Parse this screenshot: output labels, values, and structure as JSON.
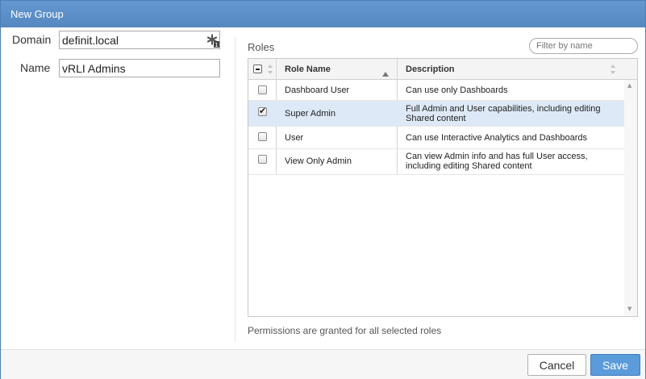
{
  "dialog": {
    "title": "New Group"
  },
  "form": {
    "domain_label": "Domain",
    "domain_value": "definit.local",
    "name_label": "Name",
    "name_value": "vRLI Admins"
  },
  "roles": {
    "label": "Roles",
    "filter_placeholder": "Filter by name",
    "columns": [
      "Role Name",
      "Description"
    ],
    "rows": [
      {
        "name": "Dashboard User",
        "description": "Can use only Dashboards",
        "checked": false
      },
      {
        "name": "Super Admin",
        "description": "Full Admin and User capabilities, including editing Shared content",
        "checked": true
      },
      {
        "name": "User",
        "description": "Can use Interactive Analytics and Dashboards",
        "checked": false
      },
      {
        "name": "View Only Admin",
        "description": "Can view Admin info and has full User access, including editing Shared content",
        "checked": false
      }
    ],
    "footnote": "Permissions are granted for all selected roles"
  },
  "footer": {
    "cancel_label": "Cancel",
    "save_label": "Save"
  },
  "colors": {
    "titlebar": "#5a8fc9",
    "selected_row": "#dde9f6",
    "primary_button": "#5b9bd9"
  }
}
